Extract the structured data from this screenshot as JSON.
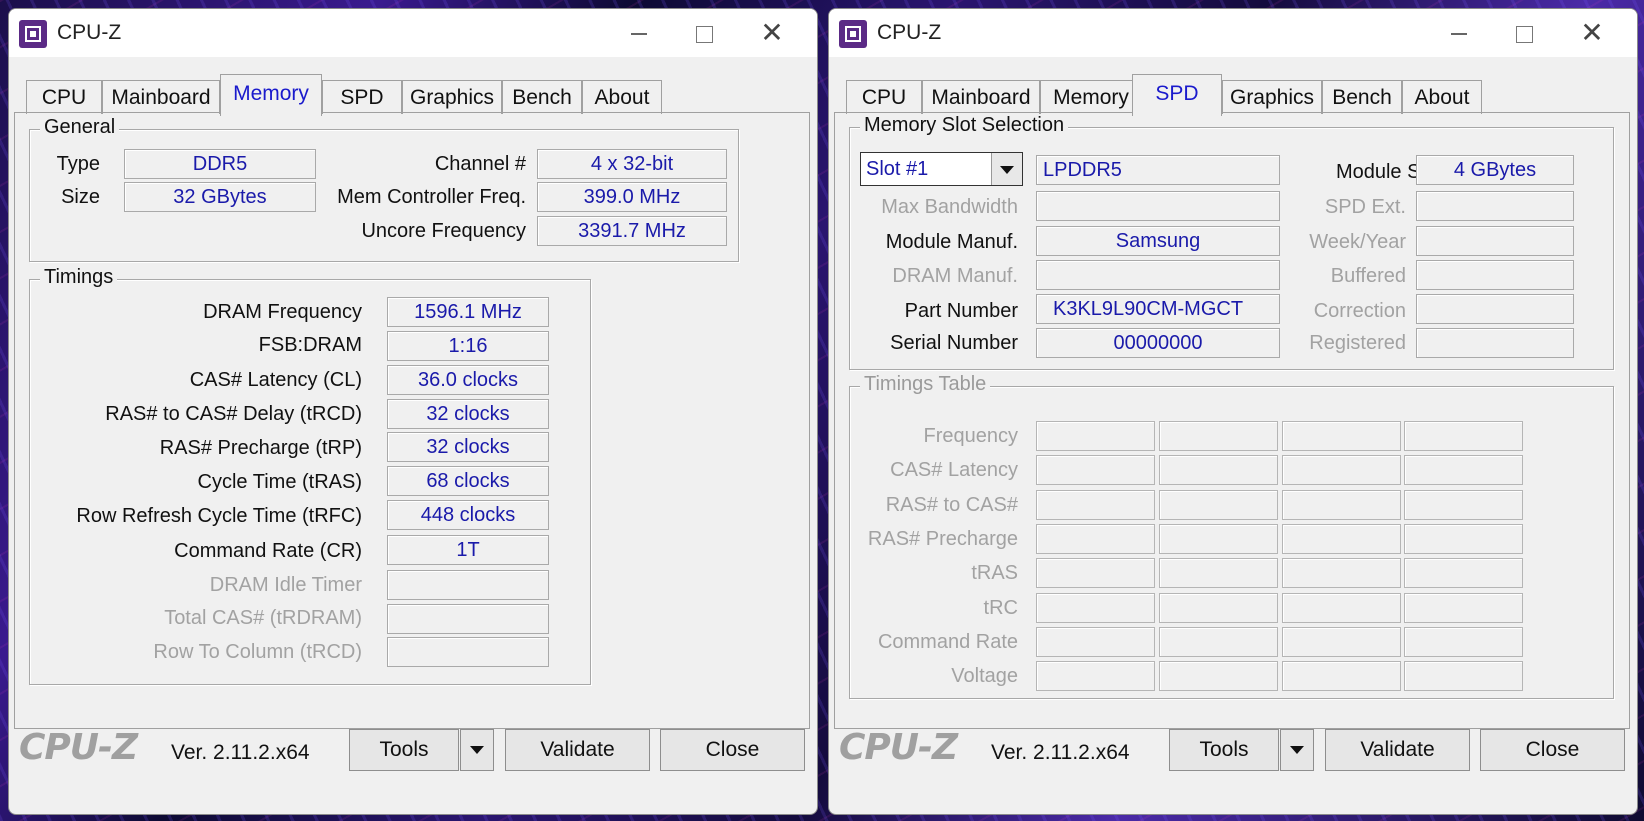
{
  "left_window": {
    "title": "CPU-Z",
    "tabs": [
      "CPU",
      "Mainboard",
      "Memory",
      "SPD",
      "Graphics",
      "Bench",
      "About"
    ],
    "active_tab": "Memory",
    "general": {
      "title": "General",
      "type_label": "Type",
      "type_value": "DDR5",
      "size_label": "Size",
      "size_value": "32 GBytes",
      "channel_label": "Channel #",
      "channel_value": "4 x 32-bit",
      "mcf_label": "Mem Controller Freq.",
      "mcf_value": "399.0 MHz",
      "uncore_label": "Uncore Frequency",
      "uncore_value": "3391.7 MHz"
    },
    "timings": {
      "title": "Timings",
      "rows": [
        {
          "label": "DRAM Frequency",
          "value": "1596.1 MHz"
        },
        {
          "label": "FSB:DRAM",
          "value": "1:16"
        },
        {
          "label": "CAS# Latency (CL)",
          "value": "36.0 clocks"
        },
        {
          "label": "RAS# to CAS# Delay (tRCD)",
          "value": "32 clocks"
        },
        {
          "label": "RAS# Precharge (tRP)",
          "value": "32 clocks"
        },
        {
          "label": "Cycle Time (tRAS)",
          "value": "68 clocks"
        },
        {
          "label": "Row Refresh Cycle Time (tRFC)",
          "value": "448 clocks"
        },
        {
          "label": "Command Rate (CR)",
          "value": "1T"
        },
        {
          "label": "DRAM Idle Timer",
          "value": ""
        },
        {
          "label": "Total CAS# (tRDRAM)",
          "value": ""
        },
        {
          "label": "Row To Column (tRCD)",
          "value": ""
        }
      ]
    },
    "footer": {
      "logo": "CPU-Z",
      "version": "Ver. 2.11.2.x64",
      "tools": "Tools",
      "validate": "Validate",
      "close": "Close"
    }
  },
  "right_window": {
    "title": "CPU-Z",
    "tabs": [
      "CPU",
      "Mainboard",
      "Memory",
      "SPD",
      "Graphics",
      "Bench",
      "About"
    ],
    "active_tab": "SPD",
    "slot": {
      "title": "Memory Slot Selection",
      "slot_value": "Slot #1",
      "type_value": "LPDDR5",
      "module_size_label": "Module Size",
      "module_size_value": "4 GBytes",
      "max_bw_label": "Max Bandwidth",
      "max_bw_value": "",
      "spd_ext_label": "SPD Ext.",
      "module_manuf_label": "Module Manuf.",
      "module_manuf_value": "Samsung",
      "week_year_label": "Week/Year",
      "dram_manuf_label": "DRAM Manuf.",
      "buffered_label": "Buffered",
      "part_label": "Part Number",
      "part_value": "K3KL9L90CM-MGCT",
      "correction_label": "Correction",
      "serial_label": "Serial Number",
      "serial_value": "00000000",
      "registered_label": "Registered"
    },
    "timings_table": {
      "title": "Timings Table",
      "rows": [
        "Frequency",
        "CAS# Latency",
        "RAS# to CAS#",
        "RAS# Precharge",
        "tRAS",
        "tRC",
        "Command Rate",
        "Voltage"
      ]
    },
    "footer": {
      "logo": "CPU-Z",
      "version": "Ver. 2.11.2.x64",
      "tools": "Tools",
      "validate": "Validate",
      "close": "Close"
    }
  }
}
